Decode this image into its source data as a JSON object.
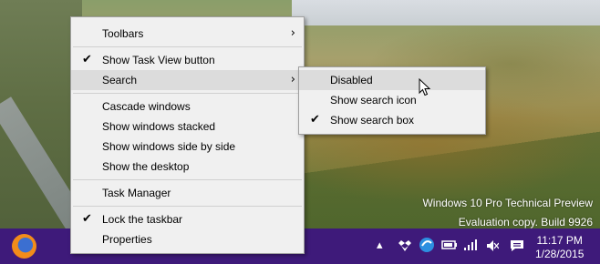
{
  "desktop": {
    "watermark": {
      "line1": "Windows 10 Pro Technical Preview",
      "line2": "Evaluation copy. Build 9926"
    }
  },
  "context_menu": {
    "items": [
      {
        "label": "Toolbars",
        "submenu_arrow": "›"
      },
      {
        "label": "Show Task View button",
        "checked": true,
        "check": "✔"
      },
      {
        "label": "Search",
        "submenu_arrow": "›",
        "highlighted": true
      },
      {
        "label": "Cascade windows"
      },
      {
        "label": "Show windows stacked"
      },
      {
        "label": "Show windows side by side"
      },
      {
        "label": "Show the desktop"
      },
      {
        "label": "Task Manager"
      },
      {
        "label": "Lock the taskbar",
        "checked": true,
        "check": "✔"
      },
      {
        "label": "Properties"
      }
    ]
  },
  "search_submenu": {
    "items": [
      {
        "label": "Disabled",
        "highlighted": true
      },
      {
        "label": "Show search icon"
      },
      {
        "label": "Show search box",
        "checked": true,
        "check": "✔"
      }
    ]
  },
  "taskbar": {
    "color": "#3e1a7a",
    "app_icons": [
      "firefox-icon"
    ],
    "tray_icons": [
      "chevron-up-icon",
      "dropbox-icon",
      "sync-icon",
      "battery-icon",
      "signal-icon",
      "volume-mute-icon",
      "notification-icon"
    ],
    "clock": {
      "time": "11:17 PM",
      "date": "1/28/2015"
    }
  }
}
